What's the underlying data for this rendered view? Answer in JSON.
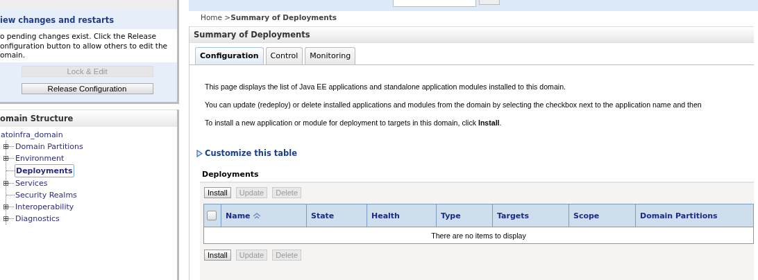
{
  "change_center": {
    "heading": "iew changes and restarts",
    "message": "o pending changes exist. Click the Release\nonfiguration button to allow others to edit the\nomain.",
    "buttons": [
      {
        "label": "Lock & Edit",
        "disabled": true
      },
      {
        "label": "Release Configuration",
        "disabled": false
      }
    ]
  },
  "domain_structure": {
    "title": "omain Structure",
    "tree": [
      {
        "label": "atoinfra_domain",
        "selected": false,
        "children": [
          {
            "label": "Domain Partitions",
            "expandable": true,
            "selected": false
          },
          {
            "label": "Environment",
            "expandable": true,
            "selected": false
          },
          {
            "label": "Deployments",
            "expandable": false,
            "selected": true
          },
          {
            "label": "Services",
            "expandable": true,
            "selected": false
          },
          {
            "label": "Security Realms",
            "expandable": false,
            "selected": false
          },
          {
            "label": "Interoperability",
            "expandable": true,
            "selected": false
          },
          {
            "label": "Diagnostics",
            "expandable": true,
            "selected": false
          }
        ]
      }
    ]
  },
  "breadcrumb": "Home >**Summary of Deployments**",
  "panel": {
    "title": "Summary of Deployments",
    "tabs": [
      {
        "label": "Configuration",
        "selected": true
      },
      {
        "label": "Control",
        "selected": false
      },
      {
        "label": "Monitoring",
        "selected": false
      }
    ],
    "paragraphs": [
      "This page displays the list of Java EE applications and standalone application modules installed to this domain.",
      "You can update (redeploy) or delete installed applications and modules from the domain by selecting the checkbox next to the application name and then",
      "To install a new application or module for deployment to targets in this domain, click **Install**."
    ],
    "customize_link": "Customize this table",
    "table_title": "Deployments",
    "toolbar_top": [
      {
        "label": "Install",
        "disabled": false
      },
      {
        "label": "Update",
        "disabled": true
      },
      {
        "label": "Delete",
        "disabled": true
      }
    ],
    "table": {
      "select_all_checked": false,
      "columns": [
        {
          "label": "Name",
          "sorted": true
        },
        {
          "label": "State",
          "sorted": false
        },
        {
          "label": "Health",
          "sorted": false
        },
        {
          "label": "Type",
          "sorted": false
        },
        {
          "label": "Targets",
          "sorted": false
        },
        {
          "label": "Scope",
          "sorted": false
        },
        {
          "label": "Domain Partitions",
          "sorted": false
        }
      ],
      "empty_message": "There are no items to display"
    },
    "toolbar_bottom": [
      {
        "label": "Install",
        "disabled": false
      },
      {
        "label": "Update",
        "disabled": true
      },
      {
        "label": "Delete",
        "disabled": true
      }
    ]
  }
}
